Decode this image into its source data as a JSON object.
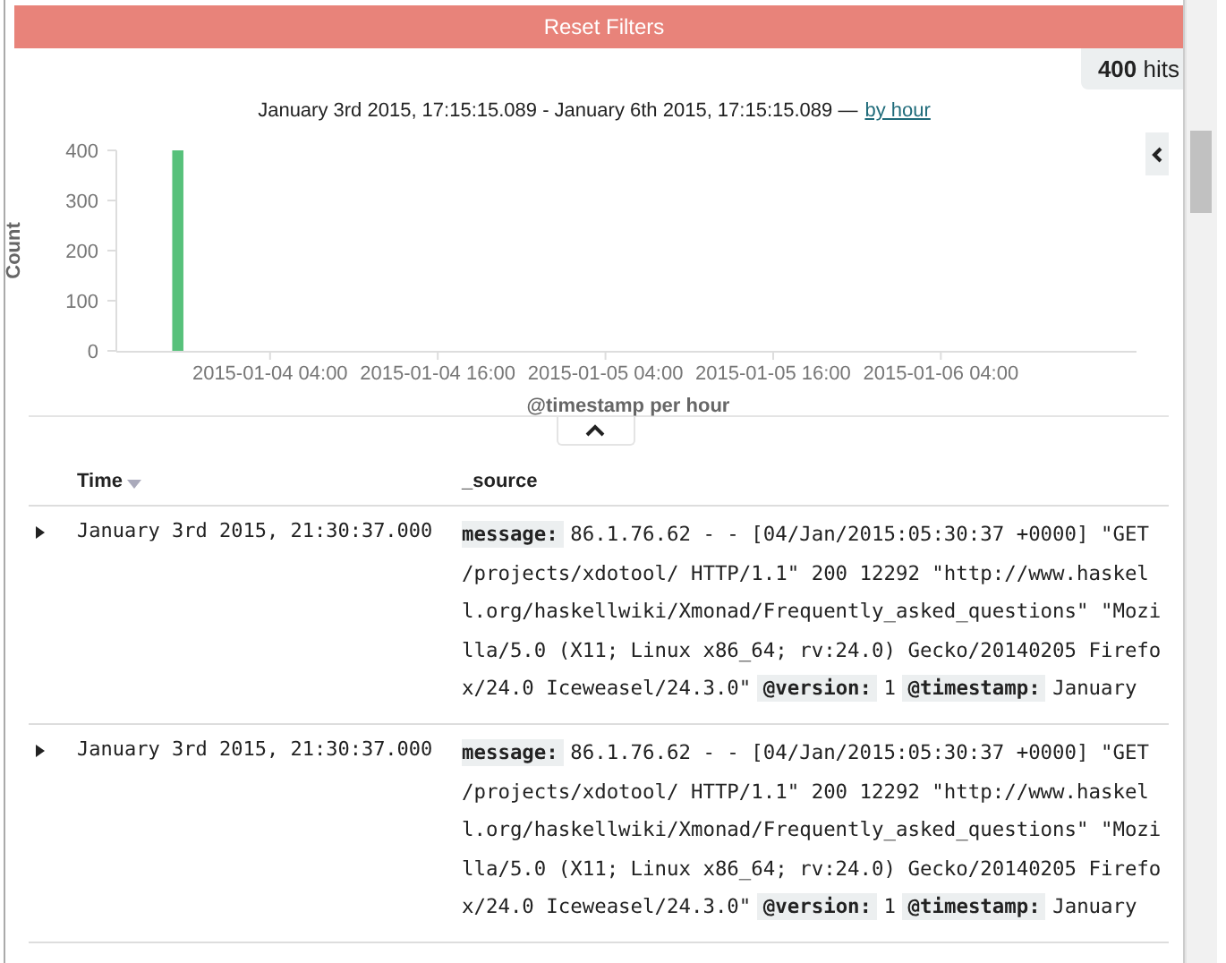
{
  "reset_button": {
    "label": "Reset Filters"
  },
  "hits": {
    "count": "400",
    "label": "hits"
  },
  "time_range": {
    "text": "January 3rd 2015, 17:15:15.089 - January 6th 2015, 17:15:15.089 —",
    "interval_link": "by hour"
  },
  "chart": {
    "chart_data": {
      "type": "bar",
      "xlabel": "@timestamp per hour",
      "ylabel": "Count",
      "x": [
        "2015-01-03T21:00"
      ],
      "values": [
        400
      ],
      "xlim": [
        "2015-01-03T17:00",
        "2015-01-06T18:00"
      ],
      "ylim": [
        0,
        400
      ],
      "yticks": [
        0,
        100,
        200,
        300,
        400
      ],
      "xticks": [
        {
          "value": "2015-01-04T04:00",
          "label": "2015-01-04 04:00"
        },
        {
          "value": "2015-01-04T16:00",
          "label": "2015-01-04 16:00"
        },
        {
          "value": "2015-01-05T04:00",
          "label": "2015-01-05 04:00"
        },
        {
          "value": "2015-01-05T16:00",
          "label": "2015-01-05 16:00"
        },
        {
          "value": "2015-01-06T04:00",
          "label": "2015-01-06 04:00"
        }
      ],
      "color": "#57c17b"
    }
  },
  "table": {
    "columns": [
      {
        "label": "Time",
        "sorted": true
      },
      {
        "label": "_source",
        "sorted": false
      }
    ],
    "rows": [
      {
        "expanded": false,
        "time": "January 3rd 2015, 21:30:37.000",
        "fields": [
          {
            "name": "message:",
            "value": "86.1.76.62 - - [04/Jan/2015:05:30:37 +0000] \"GET /projects/xdotool/ HTTP/1.1\" 200 12292 \"http://www.haskell.org/haskellwiki/Xmonad/Frequently_asked_questions\" \"Mozilla/5.0 (X11; Linux x86_64; rv:24.0) Gecko/20140205 Firefox/24.0 Iceweasel/24.3.0\""
          },
          {
            "name": "@version:",
            "value": "1"
          },
          {
            "name": "@timestamp:",
            "value": "January"
          }
        ]
      },
      {
        "expanded": false,
        "time": "January 3rd 2015, 21:30:37.000",
        "fields": [
          {
            "name": "message:",
            "value": "86.1.76.62 - - [04/Jan/2015:05:30:37 +0000] \"GET /projects/xdotool/ HTTP/1.1\" 200 12292 \"http://www.haskell.org/haskellwiki/Xmonad/Frequently_asked_questions\" \"Mozilla/5.0 (X11; Linux x86_64; rv:24.0) Gecko/20140205 Firefox/24.0 Iceweasel/24.3.0\""
          },
          {
            "name": "@version:",
            "value": "1"
          },
          {
            "name": "@timestamp:",
            "value": "January"
          }
        ]
      }
    ]
  }
}
